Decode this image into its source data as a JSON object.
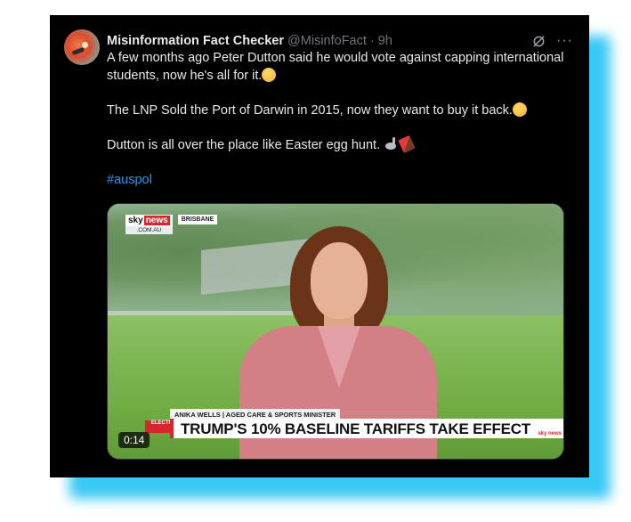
{
  "tweet": {
    "author_name": "Misinformation Fact Checker",
    "handle_time": "@MisinfoFact · 9h",
    "more_label": "···",
    "line1": "A few months ago Peter Dutton said he would vote against capping international students, now he's all for it.",
    "line2": "The LNP Sold the Port of Darwin in 2015, now they want to buy it back.",
    "line3": "Dutton is all over the place like Easter egg hunt.",
    "hashtag": "#auspol",
    "emojis": [
      "face-with-raised-eyebrow-icon",
      "face-with-raised-eyebrow-icon",
      "rabbit-icon",
      "chocolate-bar-icon"
    ]
  },
  "video": {
    "brand_sky": "sky",
    "brand_news": "news",
    "brand_domain": ".COM.AU",
    "location": "BRISBANE",
    "name_strip": "ANIKA WELLS | AGED CARE & SPORTS MINISTER",
    "election_tag": "ELECTION",
    "headline": "TRUMP'S 10% BASELINE TARIFFS TAKE EFFECT",
    "corner_brand": "sky news",
    "timestamp": "0:14"
  },
  "colors": {
    "card_bg": "#000000",
    "glow": "#38c8f4",
    "hashtag": "#1d9bf0",
    "sky_red": "#d8262f"
  }
}
